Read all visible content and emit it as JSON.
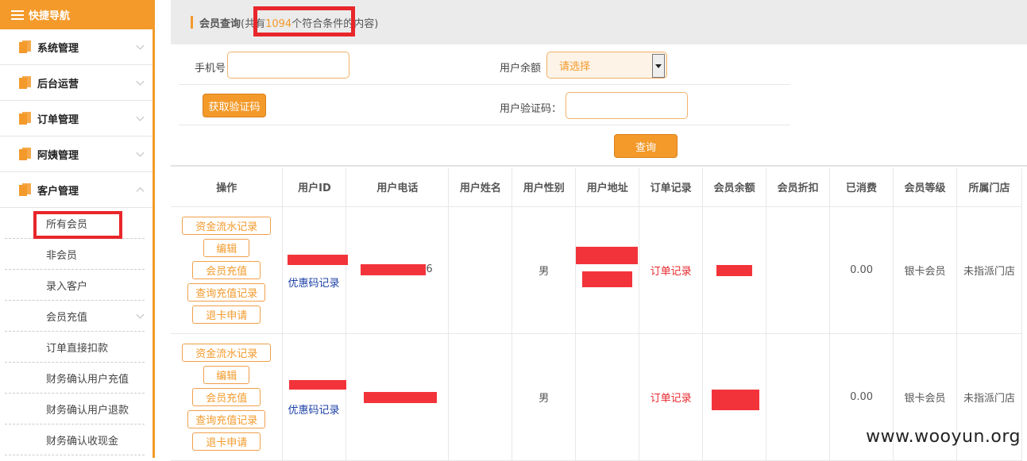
{
  "sidebar": {
    "header": "快捷导航",
    "groups": [
      {
        "label": "系统管理"
      },
      {
        "label": "后台运营"
      },
      {
        "label": "订单管理"
      },
      {
        "label": "阿姨管理"
      },
      {
        "label": "客户管理"
      }
    ],
    "subitems": [
      {
        "label": "所有会员"
      },
      {
        "label": "非会员"
      },
      {
        "label": "录入客户"
      },
      {
        "label": "会员充值"
      },
      {
        "label": "订单直接扣款"
      },
      {
        "label": "财务确认用户充值"
      },
      {
        "label": "财务确认用户退款"
      },
      {
        "label": "财务确认收现金"
      }
    ]
  },
  "topbar": {
    "title": "会员查询",
    "prefix": "(共有",
    "count": "1094",
    "suffix": "个符合条件的内容)"
  },
  "form": {
    "phone_label": "手机号",
    "balance_label": "用户余额",
    "balance_selected": "请选择",
    "get_code_button": "获取验证码",
    "code_label": "用户验证码：",
    "query_button": "查询"
  },
  "table": {
    "headers": [
      "操作",
      "用户ID",
      "用户电话",
      "用户姓名",
      "用户性别",
      "用户地址",
      "订单记录",
      "会员余额",
      "会员折扣",
      "已消费",
      "会员等级",
      "所属门店"
    ],
    "action_buttons": [
      "资金流水记录",
      "编辑",
      "会员充值",
      "查询充值记录",
      "退卡申请"
    ],
    "rows": [
      {
        "coupon": "优惠码记录",
        "phone_tail": "6",
        "gender": "男",
        "orders": "订单记录",
        "consumed": "0.00",
        "level": "银卡会员",
        "store": "未指派门店"
      },
      {
        "coupon": "优惠码记录",
        "phone_tail": "",
        "gender": "男",
        "orders": "订单记录",
        "consumed": "0.00",
        "level": "银卡会员",
        "store": "未指派门店"
      }
    ]
  },
  "watermark": "www.wooyun.org",
  "colors": {
    "accent": "#f39a2b",
    "highlight": "#e8262b"
  }
}
